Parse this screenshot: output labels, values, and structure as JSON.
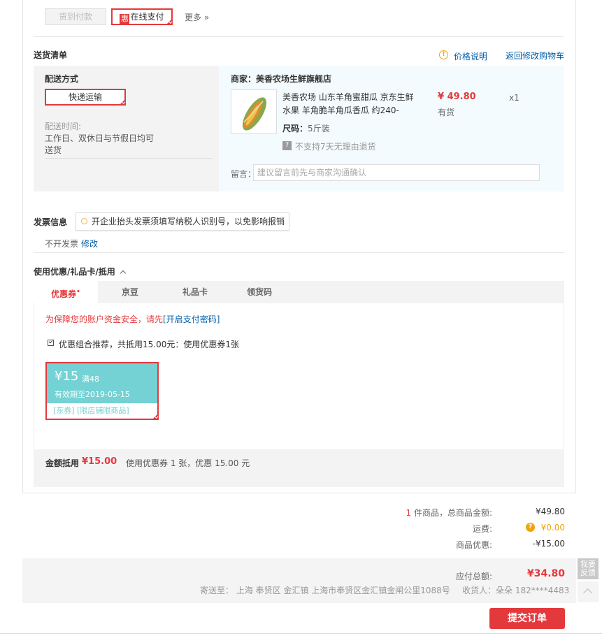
{
  "payment": {
    "cod_label": "货到付款",
    "hui": "惠",
    "online_label": "在线支付",
    "more_label": "更多 »"
  },
  "delivery": {
    "title": "送货清单",
    "price_note": "价格说明",
    "back_cart": "返回修改购物车",
    "method_title": "配送方式",
    "method_value": "快递运输",
    "time_label": "配送时间:",
    "time_value_1": "工作日、双休日与节假日均可",
    "time_value_2": "送货",
    "merchant": "商家：美香农场生鲜旗舰店",
    "product_name_1": "美香农场 山东羊角蜜甜瓜 京东生鲜",
    "product_name_2": "水果 羊角脆羊角瓜香瓜 约240-",
    "price": "¥ 49.80",
    "qty": "x1",
    "stock": "有货",
    "size_label": "尺码：",
    "size_value": "5斤装",
    "return_note": "不支持7天无理由退货",
    "message_label": "留言：",
    "message_placeholder": "建议留言前先与商家沟通确认"
  },
  "invoice": {
    "title": "发票信息",
    "tip": "开企业抬头发票须填写纳税人识别号，以免影响报销",
    "value": "不开发票",
    "edit": "修改"
  },
  "discount": {
    "title": "使用优惠/礼品卡/抵用",
    "tabs": [
      "优惠券",
      "京豆",
      "礼品卡",
      "领货码"
    ],
    "security_text": "为保障您的账户资金安全，请先",
    "security_link": "[开启支付密码]",
    "combo_text": "优惠组合推荐，共抵用15.00元：使用优惠券1张",
    "coupon_amount": "¥15",
    "coupon_threshold": "满48",
    "coupon_valid": "有效期至2019-05-15",
    "coupon_scope": "[东券] [限店铺限商品]",
    "summary_label": "金额抵用",
    "summary_amount": "¥15.00",
    "summary_detail": "使用优惠券 1 张，优惠 15.00 元"
  },
  "totals": {
    "count": "1",
    "count_label": "件商品，总商品金额:",
    "goods_total": "¥49.80",
    "freight_label": "运费:",
    "freight": "¥0.00",
    "discount_label": "商品优惠:",
    "discount": "-¥15.00",
    "payable_label": "应付总额:",
    "payable": "¥34.80",
    "address": "寄送至： 上海 奉贤区 金汇镇 上海市奉贤区金汇镇金闸公里1088号",
    "receiver": "收货人：朵朵 182****4483"
  },
  "actions": {
    "submit": "提交订单",
    "feedback": "我要反馈"
  }
}
